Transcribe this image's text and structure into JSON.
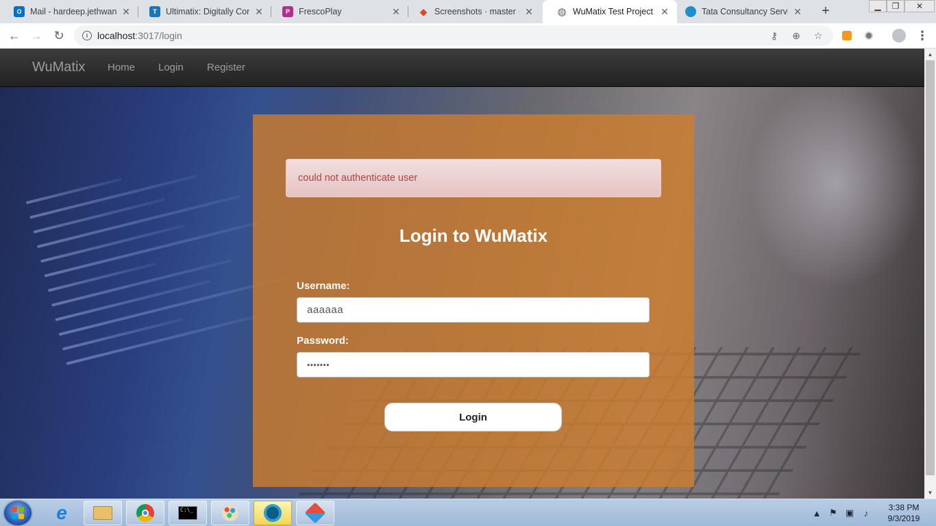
{
  "browser": {
    "tabs": [
      {
        "title": "Mail - hardeep.jethwani@",
        "favicon": "outlook-icon",
        "color": "#0072c6",
        "glyph": "O",
        "active": false
      },
      {
        "title": "Ultimatix: Digitally Conne",
        "favicon": "tata-icon",
        "color": "#1b75bc",
        "glyph": "T",
        "active": false
      },
      {
        "title": "FrescoPlay",
        "favicon": "frescoplay-icon",
        "color": "#b52e8c",
        "glyph": "P",
        "active": false
      },
      {
        "title": "Screenshots · master · Ha",
        "favicon": "gitlab-icon",
        "color": "#e24329",
        "glyph": "◆",
        "active": false
      },
      {
        "title": "WuMatix Test Project",
        "favicon": "globe-icon",
        "color": "#5f6368",
        "glyph": "◍",
        "active": true
      },
      {
        "title": "Tata Consultancy Service",
        "favicon": "tcs-icon",
        "color": "#1e90c8",
        "glyph": "◯",
        "active": false
      }
    ],
    "new_tab": "+",
    "url_host": "localhost",
    "url_path": ":3017/login"
  },
  "nav": {
    "brand": "WuMatix",
    "links": [
      "Home",
      "Login",
      "Register"
    ]
  },
  "login": {
    "alert": "could not authenticate user",
    "heading": "Login to WuMatix",
    "username_label": "Username:",
    "username_value": "aaaaaa",
    "password_label": "Password:",
    "password_value": "•••••••",
    "button": "Login"
  },
  "taskbar": {
    "apps": [
      "internet-explorer-icon",
      "file-explorer-icon",
      "chrome-icon",
      "command-prompt-icon",
      "paint-icon",
      "tcs-app-icon",
      "git-icon"
    ],
    "clock_time": "3:38 PM",
    "clock_date": "9/3/2019"
  }
}
